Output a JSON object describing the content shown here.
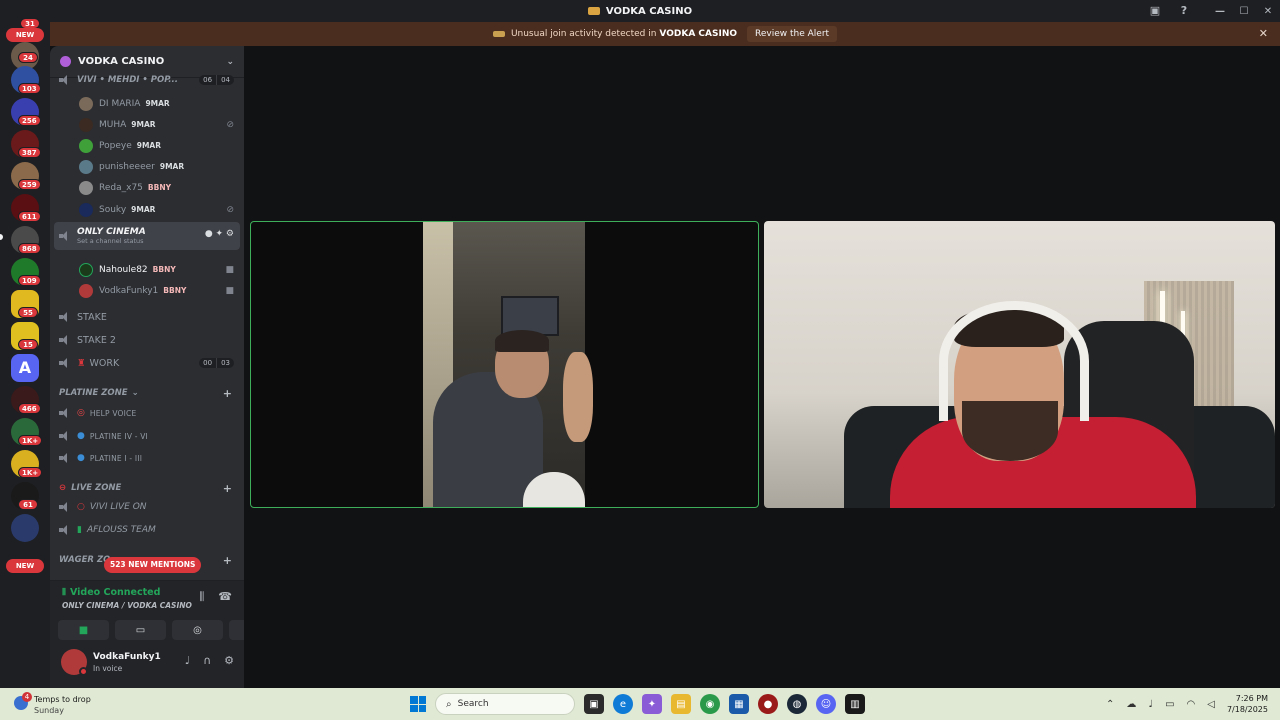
{
  "window": {
    "title": "VODKA CASINO"
  },
  "alert": {
    "message": "Unusual join activity detected in",
    "server": "VODKA CASINO",
    "action": "Review the Alert"
  },
  "rail": {
    "new_top": "NEW",
    "new_bottom": "NEW",
    "badges": [
      "24",
      "103",
      "256",
      "387",
      "259",
      "611",
      "868",
      "109",
      "55",
      "15",
      "466",
      "1K+",
      "1K+",
      "61"
    ],
    "top_badge": "31"
  },
  "server": {
    "name": "VODKA CASINO"
  },
  "channels": {
    "top_channel": "VIVI • MEHDI • POP...",
    "top_counts": [
      "06",
      "04"
    ],
    "top_members": [
      {
        "name": "DI MARIA",
        "tag": "9MAR"
      },
      {
        "name": "MUHA",
        "tag": "9MAR"
      },
      {
        "name": "Popeye",
        "tag": "9MAR"
      },
      {
        "name": "punisheeeer",
        "tag": "9MAR"
      },
      {
        "name": "Reda_x75",
        "tag": "BBNY"
      },
      {
        "name": "Souky",
        "tag": "9MAR"
      }
    ],
    "active_channel": "ONLY CINEMA",
    "active_status": "Set a channel status",
    "active_members": [
      {
        "name": "Nahoule82",
        "tag": "BBNY"
      },
      {
        "name": "VodkaFunky1",
        "tag": "BBNY"
      }
    ],
    "stake": "STAKE",
    "stake2": "STAKE 2",
    "work": "WORK",
    "work_counts": [
      "00",
      "03"
    ],
    "platine_zone": "PLATINE ZONE",
    "help_voice": "HELP VOICE",
    "platine_iv": "PLATINE IV - VI",
    "platine_i": "PLATINE I - III",
    "live_zone": "LIVE ZONE",
    "vivi_live": "VIVI LIVE ON",
    "aflouss": "AFLOUSS TEAM",
    "wager_zone": "WAGER ZO",
    "new_mentions": "523 NEW MENTIONS"
  },
  "voice": {
    "status": "Video Connected",
    "location": "ONLY CINEMA / VODKA CASINO"
  },
  "user": {
    "name": "VodkaFunky1",
    "status": "In voice"
  },
  "taskbar": {
    "weather_line1": "Temps to drop",
    "weather_line2": "Sunday",
    "weather_badge": "4",
    "search": "Search",
    "time": "7:26 PM",
    "date": "7/18/2025"
  },
  "colors": {
    "accent_green": "#23a55a",
    "danger_red": "#da373c",
    "sidebar_bg": "#2b2d31",
    "rail_bg": "#1e1f22"
  }
}
